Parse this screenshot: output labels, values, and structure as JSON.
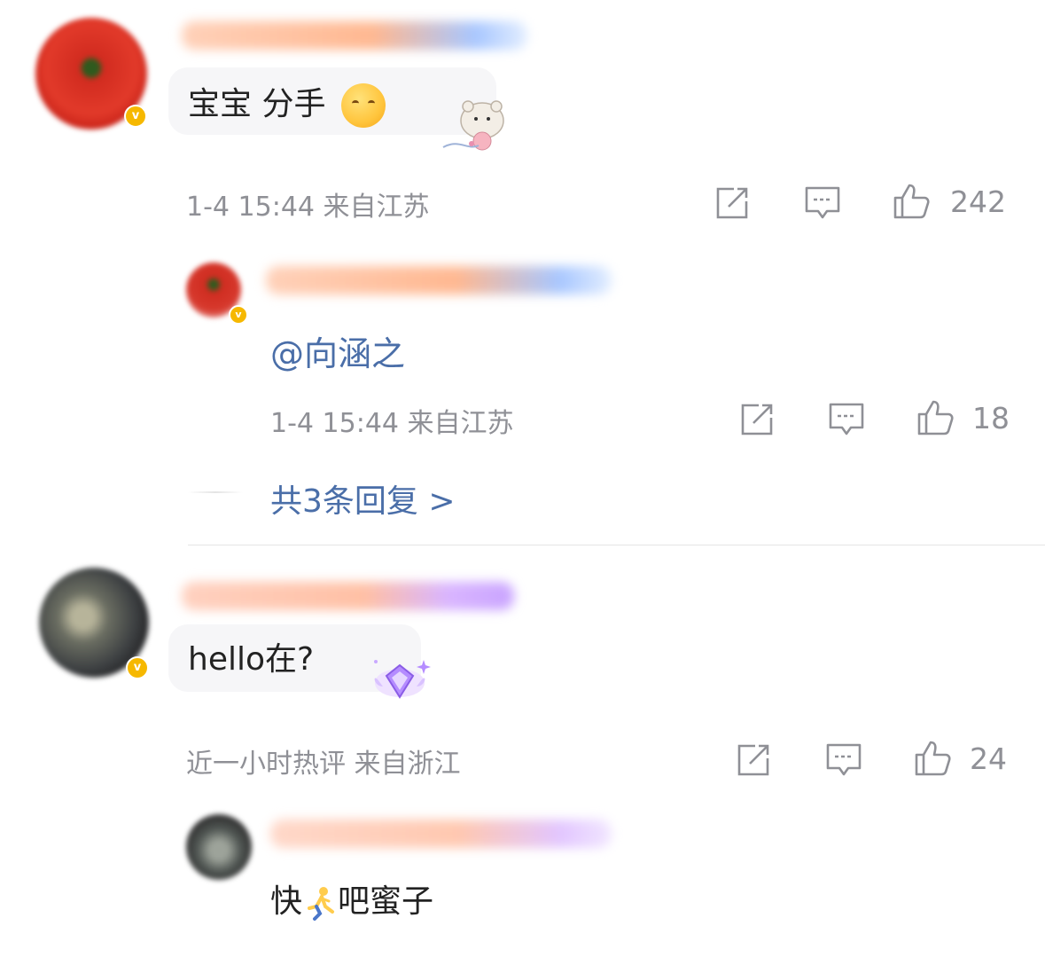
{
  "comments": [
    {
      "text": "宝宝 分手",
      "meta": "1-4 15:44 来自江苏",
      "likes": "242",
      "emoji": "hugging-face-emoji",
      "replies": [
        {
          "text": "@向涵之",
          "meta": "1-4 15:44 来自江苏",
          "likes": "18"
        }
      ],
      "more_replies_label": "共3条回复 >"
    },
    {
      "text": "hello在?",
      "meta": "近一小时热评 来自浙江",
      "likes": "24",
      "replies": [
        {
          "text_before": "快",
          "text_after": "吧蜜子",
          "emoji": "running-emoji"
        }
      ]
    }
  ],
  "colors": {
    "accent_link": "#4a6ea8",
    "meta_gray": "#8f9096",
    "bubble_bg": "#f6f6f8"
  },
  "icons": [
    "share-icon",
    "reply-icon",
    "like-icon",
    "verified-badge-icon"
  ]
}
